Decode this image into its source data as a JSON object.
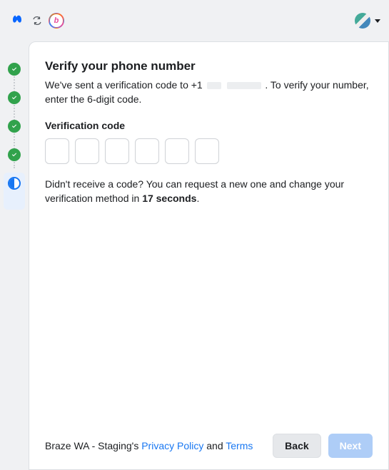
{
  "header": {
    "partner_initial": "b"
  },
  "stepper": {
    "steps": [
      {
        "state": "done"
      },
      {
        "state": "done"
      },
      {
        "state": "done"
      },
      {
        "state": "done"
      },
      {
        "state": "current"
      }
    ]
  },
  "main": {
    "title": "Verify your phone number",
    "subtitle_pre": "We've sent a verification code to +1 ",
    "subtitle_post": " . To verify your number, enter the 6-digit code.",
    "field_label": "Verification code",
    "code_count": 6,
    "help_pre": "Didn't receive a code? You can request a new one and change your verification method in ",
    "help_countdown": "17 seconds",
    "help_post": "."
  },
  "footer": {
    "legal_prefix": "Braze WA - Staging's ",
    "privacy_label": "Privacy Policy",
    "legal_joiner": " and ",
    "terms_label": "Terms",
    "back_label": "Back",
    "next_label": "Next"
  }
}
